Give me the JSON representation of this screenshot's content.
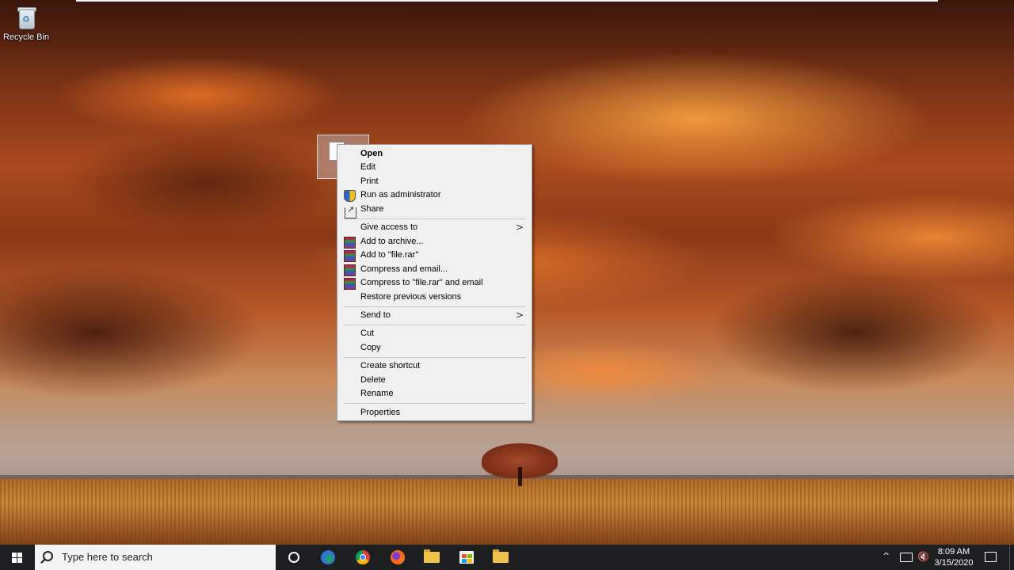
{
  "desktop": {
    "icons": [
      {
        "label": "Recycle Bin",
        "icon": "recycle-bin-icon"
      }
    ],
    "selected_file": {
      "icon": "document-icon"
    }
  },
  "context_menu": {
    "items": {
      "open": "Open",
      "edit": "Edit",
      "print": "Print",
      "run_as_admin": "Run as administrator",
      "share": "Share",
      "give_access": "Give access to",
      "add_archive": "Add to archive...",
      "add_file_rar": "Add to \"file.rar\"",
      "compress_email": "Compress and email...",
      "compress_rar_email": "Compress to \"file.rar\" and email",
      "restore_versions": "Restore previous versions",
      "send_to": "Send to",
      "cut": "Cut",
      "copy": "Copy",
      "create_shortcut": "Create shortcut",
      "delete": "Delete",
      "rename": "Rename",
      "properties": "Properties"
    },
    "submenu_arrow": ">"
  },
  "taskbar": {
    "search_placeholder": "Type here to search",
    "pinned": [
      "cortana-icon",
      "edge-icon",
      "chrome-icon",
      "firefox-icon",
      "file-explorer-icon",
      "store-icon",
      "folder-icon"
    ],
    "tray": {
      "chevron": "^",
      "time": "8:09 AM",
      "date": "3/15/2020"
    }
  },
  "colors": {
    "menu_bg": "#f0f0f0",
    "taskbar_bg": "#1d1e20",
    "search_bg": "#f3f3f3"
  }
}
